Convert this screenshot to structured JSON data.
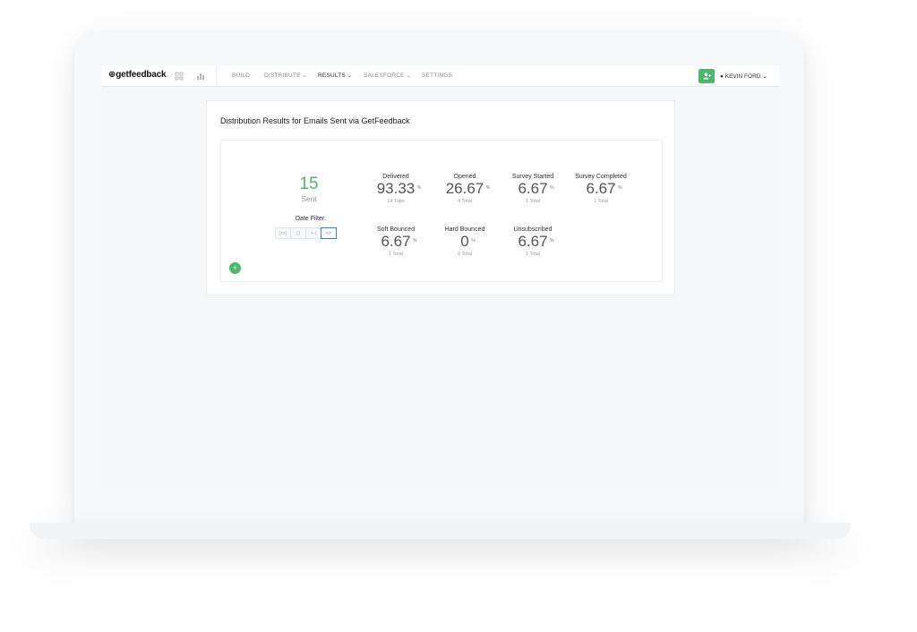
{
  "app": {
    "logo": "getfeedback"
  },
  "nav": {
    "items": [
      {
        "label": "BUILD",
        "dropdown": false,
        "active": false
      },
      {
        "label": "DISTRIBUTE",
        "dropdown": true,
        "active": false
      },
      {
        "label": "RESULTS",
        "dropdown": true,
        "active": true
      },
      {
        "label": "SALESFORCE",
        "dropdown": true,
        "active": false
      },
      {
        "label": "SETTINGS",
        "dropdown": false,
        "active": false
      }
    ],
    "caret": "⌄",
    "user_name": "KEVIN FORD",
    "accent_color": "#4cb86b"
  },
  "card": {
    "title": "Distribution Results for Emails Sent via GetFeedback"
  },
  "summary": {
    "sent_value": "15",
    "sent_label": "Sent",
    "date_filter_label": "Date Filter:",
    "date_filter_buttons": [
      "|<>|",
      "▢",
      "<-|",
      "<>"
    ],
    "add_label": "+"
  },
  "stats": [
    {
      "label": "Delivered",
      "value": "93.33",
      "unit": "%",
      "total": "14 Total"
    },
    {
      "label": "Opened",
      "value": "26.67",
      "unit": "%",
      "total": "4 Total"
    },
    {
      "label": "Survey Started",
      "value": "6.67",
      "unit": "%",
      "total": "1 Total"
    },
    {
      "label": "Survey Completed",
      "value": "6.67",
      "unit": "%",
      "total": "1 Total"
    },
    {
      "label": "Soft Bounced",
      "value": "6.67",
      "unit": "%",
      "total": "1 Total"
    },
    {
      "label": "Hard Bounced",
      "value": "0",
      "unit": "%",
      "total": "0 Total"
    },
    {
      "label": "Unsubscribed",
      "value": "6.67",
      "unit": "%",
      "total": "1 Total"
    }
  ]
}
